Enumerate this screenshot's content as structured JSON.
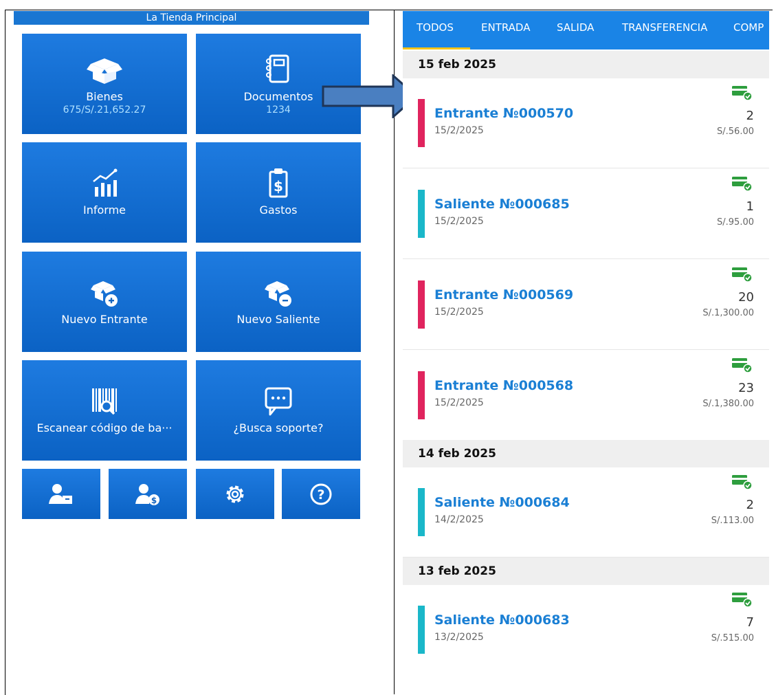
{
  "home": {
    "store_name": "La Tienda Principal",
    "tiles": {
      "goods": {
        "label": "Bienes",
        "sub": "675/S/.21,652.27"
      },
      "documents": {
        "label": "Documentos",
        "sub": "1234"
      },
      "report": {
        "label": "Informe"
      },
      "expenses": {
        "label": "Gastos"
      },
      "new_incoming": {
        "label": "Nuevo Entrante"
      },
      "new_outgoing": {
        "label": "Nuevo Saliente"
      },
      "scan": {
        "label": "Escanear código de ba···"
      },
      "support": {
        "label": "¿Busca soporte?"
      }
    },
    "small_buttons": [
      "suppliers-icon",
      "customers-icon",
      "settings-icon",
      "help-icon"
    ]
  },
  "documents": {
    "tabs": [
      "TODOS",
      "ENTRADA",
      "SALIDA",
      "TRANSFERENCIA",
      "COMP"
    ],
    "active_tab": "TODOS",
    "groups": [
      {
        "date": "15 feb 2025",
        "items": [
          {
            "title": "Entrante №000570",
            "date": "15/2/2025",
            "qty": "2",
            "amount": "S/.56.00",
            "kind": "incoming"
          },
          {
            "title": "Saliente №000685",
            "date": "15/2/2025",
            "qty": "1",
            "amount": "S/.95.00",
            "kind": "outgoing"
          },
          {
            "title": "Entrante №000569",
            "date": "15/2/2025",
            "qty": "20",
            "amount": "S/.1,300.00",
            "kind": "incoming"
          },
          {
            "title": "Entrante №000568",
            "date": "15/2/2025",
            "qty": "23",
            "amount": "S/.1,380.00",
            "kind": "incoming"
          }
        ]
      },
      {
        "date": "14 feb 2025",
        "items": [
          {
            "title": "Saliente №000684",
            "date": "14/2/2025",
            "qty": "2",
            "amount": "S/.113.00",
            "kind": "outgoing"
          }
        ]
      },
      {
        "date": "13 feb 2025",
        "items": [
          {
            "title": "Saliente №000683",
            "date": "13/2/2025",
            "qty": "7",
            "amount": "S/.515.00",
            "kind": "outgoing"
          }
        ]
      }
    ]
  },
  "colors": {
    "incoming": "#e0245e",
    "outgoing": "#1ab7c9",
    "accent": "#1a84e6",
    "paid": "#2e9e3e"
  }
}
